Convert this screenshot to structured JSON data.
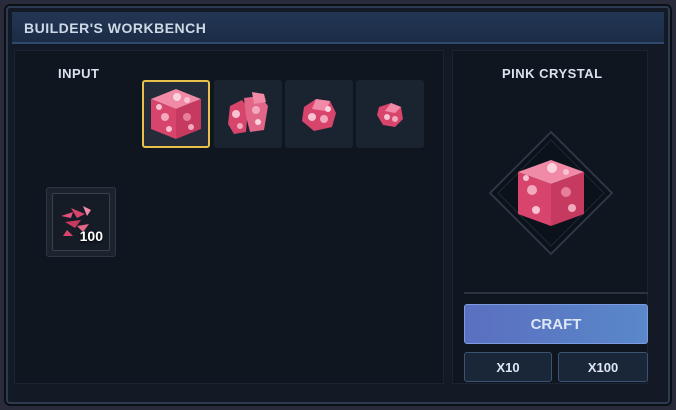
{
  "window": {
    "title": "BUILDER'S WORKBENCH"
  },
  "input": {
    "label": "INPUT",
    "slots": [
      {
        "icon": "pink-crystal-block-icon",
        "selected": true
      },
      {
        "icon": "pink-crystal-cluster-icon",
        "selected": false
      },
      {
        "icon": "pink-crystal-chunk-icon",
        "selected": false
      },
      {
        "icon": "pink-crystal-shard-icon",
        "selected": false
      }
    ],
    "resource": {
      "icon": "pink-crystal-shards-icon",
      "count": "100"
    }
  },
  "output": {
    "title": "PINK CRYSTAL",
    "icon": "pink-crystal-block-icon"
  },
  "actions": {
    "craft_label": "CRAFT",
    "x10_label": "X10",
    "x100_label": "X100"
  },
  "colors": {
    "accent_selected": "#e8c14a",
    "craft_button": "#5a7cc5",
    "crystal_pink": "#e0557a"
  }
}
